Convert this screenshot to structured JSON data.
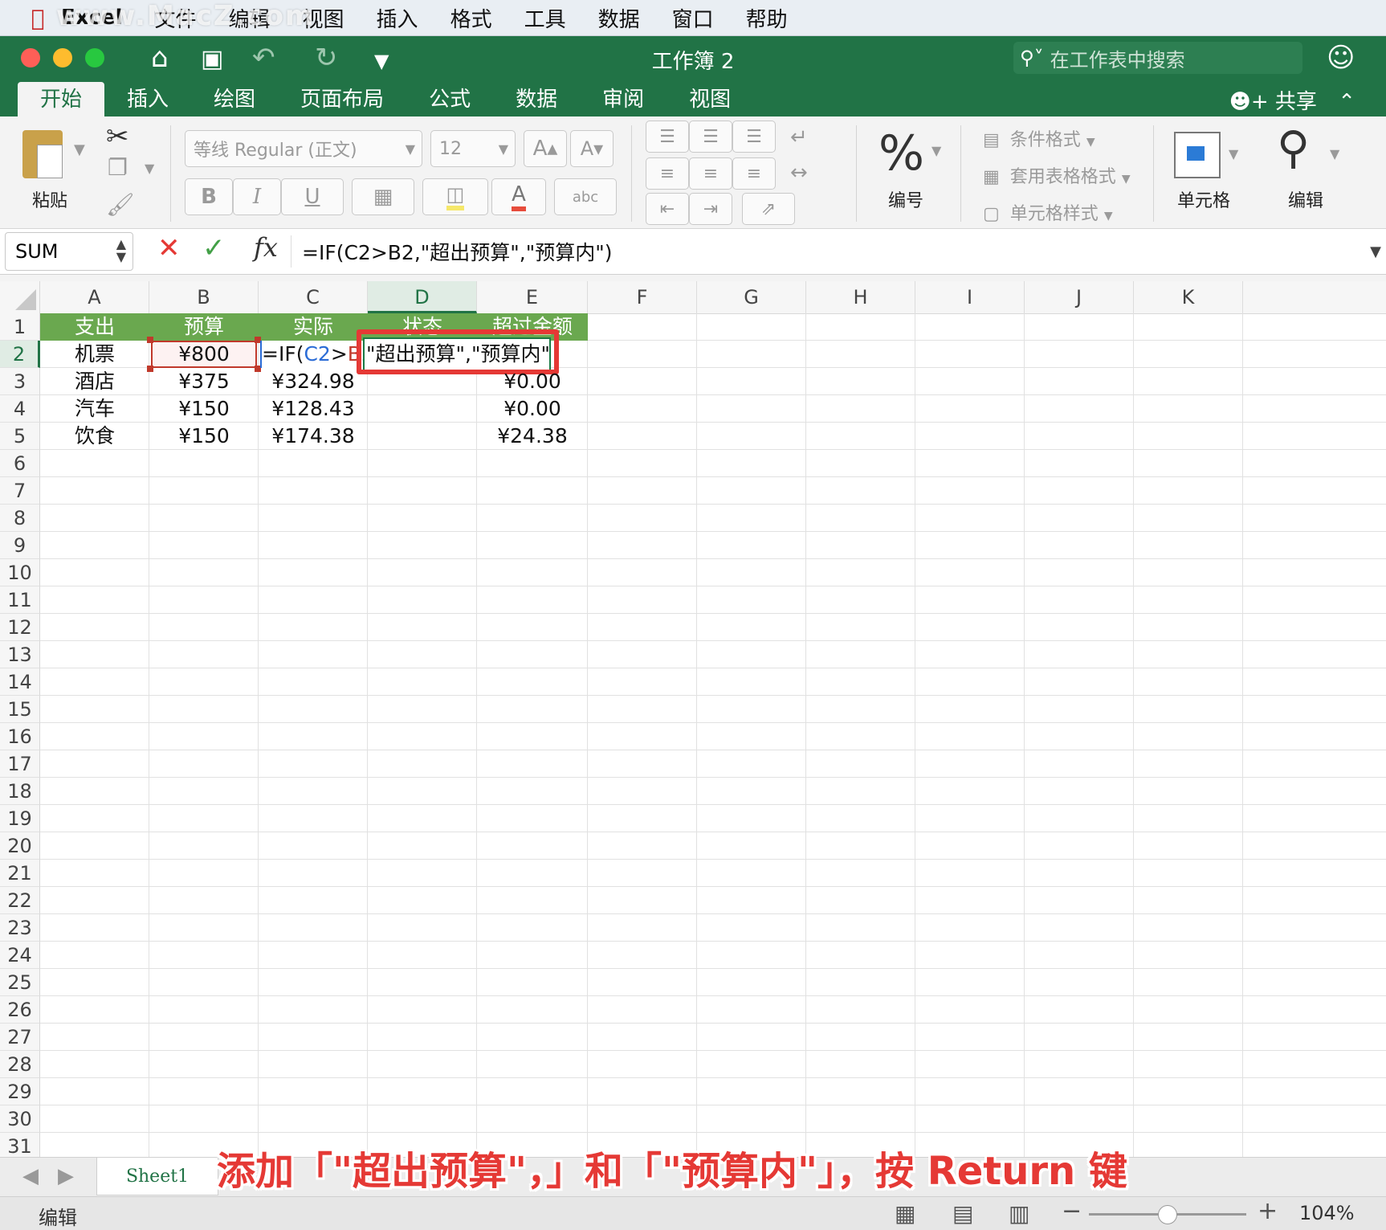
{
  "menubar": {
    "app_name": "Excel",
    "items": [
      "文件",
      "编辑",
      "视图",
      "插入",
      "格式",
      "工具",
      "数据",
      "窗口",
      "帮助"
    ]
  },
  "watermark": "www.MacZ.com",
  "window": {
    "title": "工作簿 2"
  },
  "search": {
    "placeholder": "在工作表中搜索"
  },
  "tabs": [
    "开始",
    "插入",
    "绘图",
    "页面布局",
    "公式",
    "数据",
    "审阅",
    "视图"
  ],
  "share_label": "共享",
  "ribbon": {
    "paste_label": "粘贴",
    "font_name": "等线 Regular (正文)",
    "font_size": "12",
    "bold": "B",
    "italic": "I",
    "underline": "U",
    "number_label": "编号",
    "conditional_format": "条件格式",
    "table_format": "套用表格格式",
    "cell_style": "单元格样式",
    "cells_label": "单元格",
    "edit_label": "编辑"
  },
  "formula_bar": {
    "name_box": "SUM",
    "formula": "=IF(C2>B2,\"超出预算\",\"预算内\")"
  },
  "columns": [
    "A",
    "B",
    "C",
    "D",
    "E",
    "F",
    "G",
    "H",
    "I",
    "J",
    "K"
  ],
  "selected_column": "D",
  "rows": [
    "1",
    "2",
    "3",
    "4",
    "5",
    "6",
    "7",
    "8",
    "9",
    "10",
    "11",
    "12",
    "13",
    "14",
    "15",
    "16",
    "17",
    "18",
    "19",
    "20",
    "21",
    "22",
    "23",
    "24",
    "25",
    "26",
    "27",
    "28",
    "29",
    "30",
    "31"
  ],
  "table": {
    "headers": [
      "支出",
      "预算",
      "实际",
      "状态",
      "超过金额"
    ],
    "data": [
      [
        "机票",
        "¥800",
        "",
        "",
        ""
      ],
      [
        "酒店",
        "¥375",
        "¥324.98",
        "",
        "¥0.00"
      ],
      [
        "汽车",
        "¥150",
        "¥128.43",
        "",
        "¥0.00"
      ],
      [
        "饮食",
        "¥150",
        "¥174.38",
        "",
        "¥24.38"
      ]
    ]
  },
  "edit_cell": {
    "part1": "=IF(",
    "ref_c2": "C2",
    "gt": ">",
    "ref_b2": "B2",
    "tail": "\"超出预算\",\"预算内\")"
  },
  "sheet_tab": "Sheet1",
  "status": {
    "mode": "编辑",
    "zoom": "104%"
  },
  "caption": "添加「\"超出预算\"，」和「\"预算内\"」，按 Return 键",
  "colors": {
    "excel_green": "#217346",
    "header_fill": "#6aa84f",
    "highlight_red": "#e53935"
  }
}
